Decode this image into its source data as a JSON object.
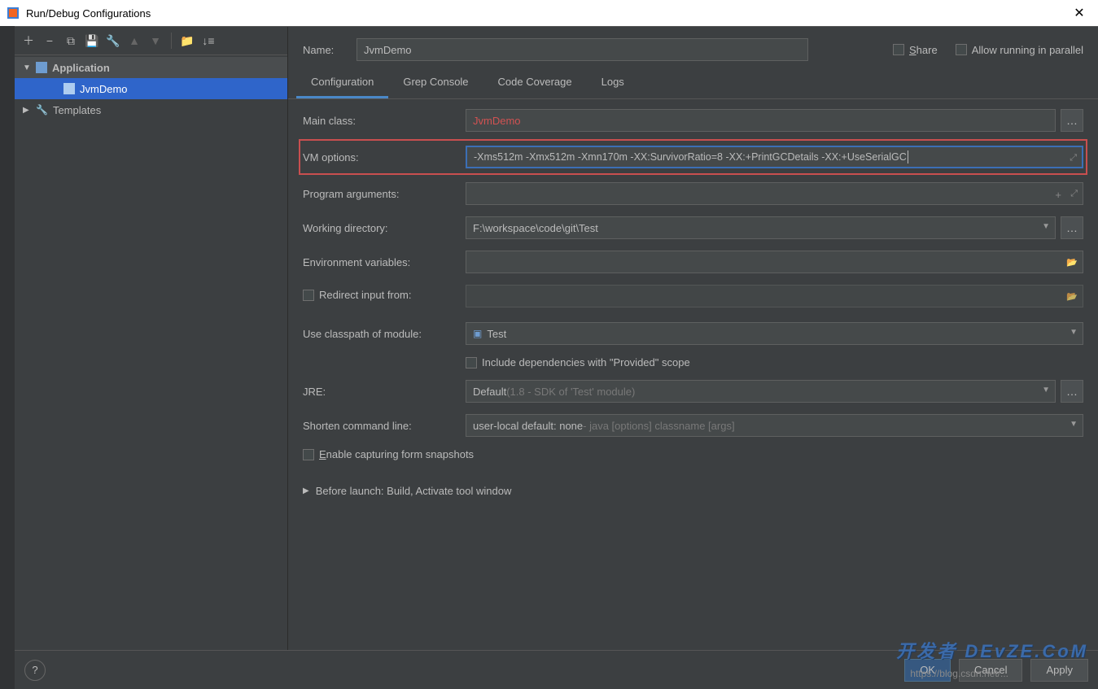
{
  "title": "Run/Debug Configurations",
  "sidebar": {
    "nodes": {
      "application": "Application",
      "item": "JvmDemo",
      "templates": "Templates"
    }
  },
  "header": {
    "name_label": "Name:",
    "name_value": "JvmDemo",
    "share": "Share",
    "allow_parallel": "Allow running in parallel"
  },
  "tabs": {
    "configuration": "Configuration",
    "grep": "Grep Console",
    "coverage": "Code Coverage",
    "logs": "Logs"
  },
  "form": {
    "main_class_label": "Main class:",
    "main_class_value": "JvmDemo",
    "vm_label": "VM options:",
    "vm_value": "-Xms512m -Xmx512m -Xmn170m -XX:SurvivorRatio=8 -XX:+PrintGCDetails -XX:+UseSerialGC",
    "prog_args_label": "Program arguments:",
    "prog_args_value": "",
    "workdir_label": "Working directory:",
    "workdir_value": "F:\\workspace\\code\\git\\Test",
    "env_label": "Environment variables:",
    "env_value": "",
    "redirect_label": "Redirect input from:",
    "redirect_value": "",
    "classpath_label": "Use classpath of module:",
    "classpath_value": "Test",
    "include_provided": "Include dependencies with \"Provided\" scope",
    "jre_label": "JRE:",
    "jre_value": "Default ",
    "jre_hint": "(1.8 - SDK of 'Test' module)",
    "shorten_label": "Shorten command line:",
    "shorten_value": "user-local default: none ",
    "shorten_hint": "- java [options] classname [args]",
    "enable_snapshots": "Enable capturing form snapshots",
    "before_launch": "Before launch: Build, Activate tool window"
  },
  "footer": {
    "ok": "OK",
    "cancel": "Cancel",
    "apply": "Apply"
  },
  "watermark": "开发者 DEvZE.CoM",
  "watermark_url": "https://blog.csdn.net/..."
}
